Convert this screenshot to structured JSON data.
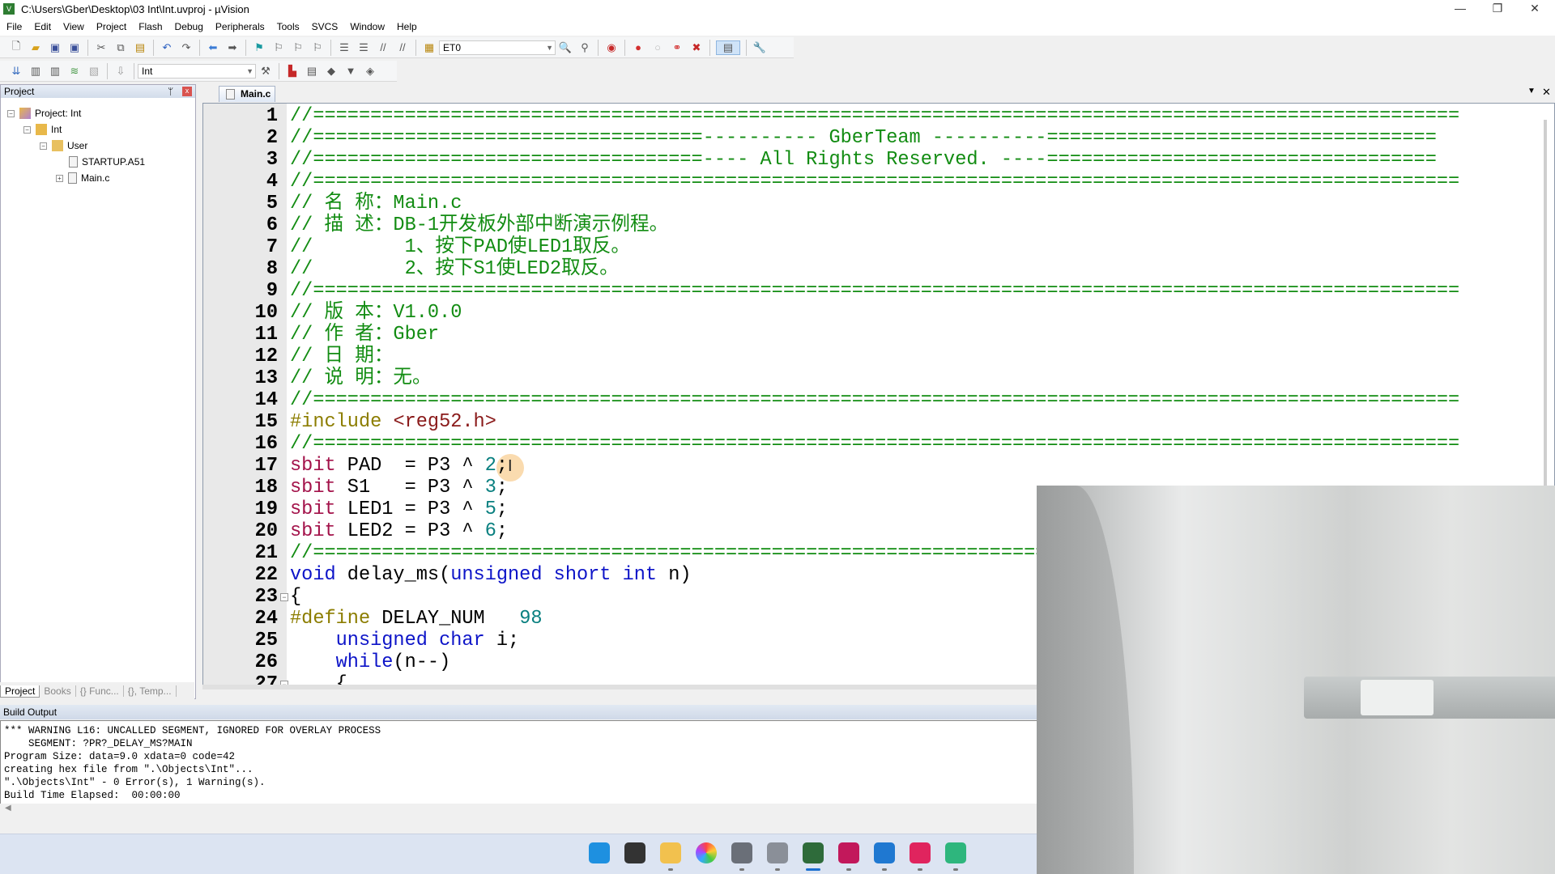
{
  "window": {
    "title": "C:\\Users\\Gber\\Desktop\\03 Int\\Int.uvproj - µVision",
    "minimize": "—",
    "maximize": "❐",
    "close": "✕"
  },
  "menu": [
    "File",
    "Edit",
    "View",
    "Project",
    "Flash",
    "Debug",
    "Peripherals",
    "Tools",
    "SVCS",
    "Window",
    "Help"
  ],
  "toolbar1": {
    "find_combo": "ET0"
  },
  "toolbar2": {
    "target_combo": "Int"
  },
  "project_panel": {
    "title": "Project",
    "pin": "ᛘ",
    "close": "x",
    "tree": [
      "Project: Int",
      "Int",
      "User",
      "STARTUP.A51",
      "Main.c"
    ],
    "tabs": [
      "Project",
      "Books",
      "{} Func...",
      "{}, Temp..."
    ]
  },
  "editor": {
    "tab": "Main.c",
    "lines": [
      [
        [
          "c",
          "//===================================================================================================="
        ]
      ],
      [
        [
          "c",
          "//==================================---------- GberTeam ----------=================================="
        ]
      ],
      [
        [
          "c",
          "//==================================---- All Rights Reserved. ----=================================="
        ]
      ],
      [
        [
          "c",
          "//===================================================================================================="
        ]
      ],
      [
        [
          "c",
          "// 名 称：Main.c"
        ]
      ],
      [
        [
          "c",
          "// 描 述：DB-1开发板外部中断演示例程。"
        ]
      ],
      [
        [
          "c",
          "//        1、按下PAD使LED1取反。"
        ]
      ],
      [
        [
          "c",
          "//        2、按下S1使LED2取反。"
        ]
      ],
      [
        [
          "c",
          "//===================================================================================================="
        ]
      ],
      [
        [
          "c",
          "// 版 本：V1.0.0"
        ]
      ],
      [
        [
          "c",
          "// 作 者：Gber"
        ]
      ],
      [
        [
          "c",
          "// 日 期："
        ]
      ],
      [
        [
          "c",
          "// 说 明：无。"
        ]
      ],
      [
        [
          "c",
          "//===================================================================================================="
        ]
      ],
      [
        [
          "p",
          "#include "
        ],
        [
          "h",
          "<reg52.h>"
        ]
      ],
      [
        [
          "c",
          "//===================================================================================================="
        ]
      ],
      [
        [
          "s",
          "sbit"
        ],
        [
          "t",
          " PAD  = P3 ^ "
        ],
        [
          "n",
          "2"
        ],
        [
          "t",
          ";"
        ]
      ],
      [
        [
          "s",
          "sbit"
        ],
        [
          "t",
          " S1   = P3 ^ "
        ],
        [
          "n",
          "3"
        ],
        [
          "t",
          ";"
        ]
      ],
      [
        [
          "s",
          "sbit"
        ],
        [
          "t",
          " LED1 = P3 ^ "
        ],
        [
          "n",
          "5"
        ],
        [
          "t",
          ";"
        ]
      ],
      [
        [
          "s",
          "sbit"
        ],
        [
          "t",
          " LED2 = P3 ^ "
        ],
        [
          "n",
          "6"
        ],
        [
          "t",
          ";"
        ]
      ],
      [
        [
          "c",
          "//===================================================================================================="
        ]
      ],
      [
        [
          "k",
          "void"
        ],
        [
          "t",
          " delay_ms("
        ],
        [
          "k",
          "unsigned short int"
        ],
        [
          "t",
          " n)"
        ]
      ],
      [
        [
          "t",
          "{"
        ]
      ],
      [
        [
          "p",
          "#define"
        ],
        [
          "t",
          " DELAY_NUM   "
        ],
        [
          "n",
          "98"
        ]
      ],
      [
        [
          "t",
          "    "
        ],
        [
          "k",
          "unsigned char"
        ],
        [
          "t",
          " i;"
        ]
      ],
      [
        [
          "t",
          "    "
        ],
        [
          "k",
          "while"
        ],
        [
          "t",
          "(n--)"
        ]
      ],
      [
        [
          "t",
          "    {"
        ]
      ]
    ]
  },
  "build_output": {
    "title": "Build Output",
    "lines": [
      "*** WARNING L16: UNCALLED SEGMENT, IGNORED FOR OVERLAY PROCESS",
      "    SEGMENT: ?PR?_DELAY_MS?MAIN",
      "Program Size: data=9.0 xdata=0 code=42",
      "creating hex file from \".\\Objects\\Int\"...",
      "\".\\Objects\\Int\" - 0 Error(s), 1 Warning(s).",
      "Build Time Elapsed:  00:00:00"
    ]
  },
  "taskbar": [
    {
      "icon": "start-icon",
      "color": "#1e90e0"
    },
    {
      "icon": "task-view-icon",
      "color": "#333333"
    },
    {
      "icon": "file-explorer-icon",
      "color": "#f2c14e"
    },
    {
      "icon": "color-app-icon",
      "color": "#e84393"
    },
    {
      "icon": "camera-icon",
      "color": "#6a6f78"
    },
    {
      "icon": "microphone-icon",
      "color": "#8a8f98"
    },
    {
      "icon": "keil-uvision-icon",
      "color": "#2e6b3a"
    },
    {
      "icon": "stm-tool-icon",
      "color": "#c2185b"
    },
    {
      "icon": "photos-icon",
      "color": "#1f78d1"
    },
    {
      "icon": "wps-pdf-icon",
      "color": "#e0245e"
    },
    {
      "icon": "wps-sheets-icon",
      "color": "#2eb67d"
    }
  ],
  "colors": {
    "comment": "#128c12",
    "keyword": "#0d14c8",
    "sbit": "#a3124a",
    "number": "#0a8080",
    "preprocessor": "#8c7d00"
  }
}
